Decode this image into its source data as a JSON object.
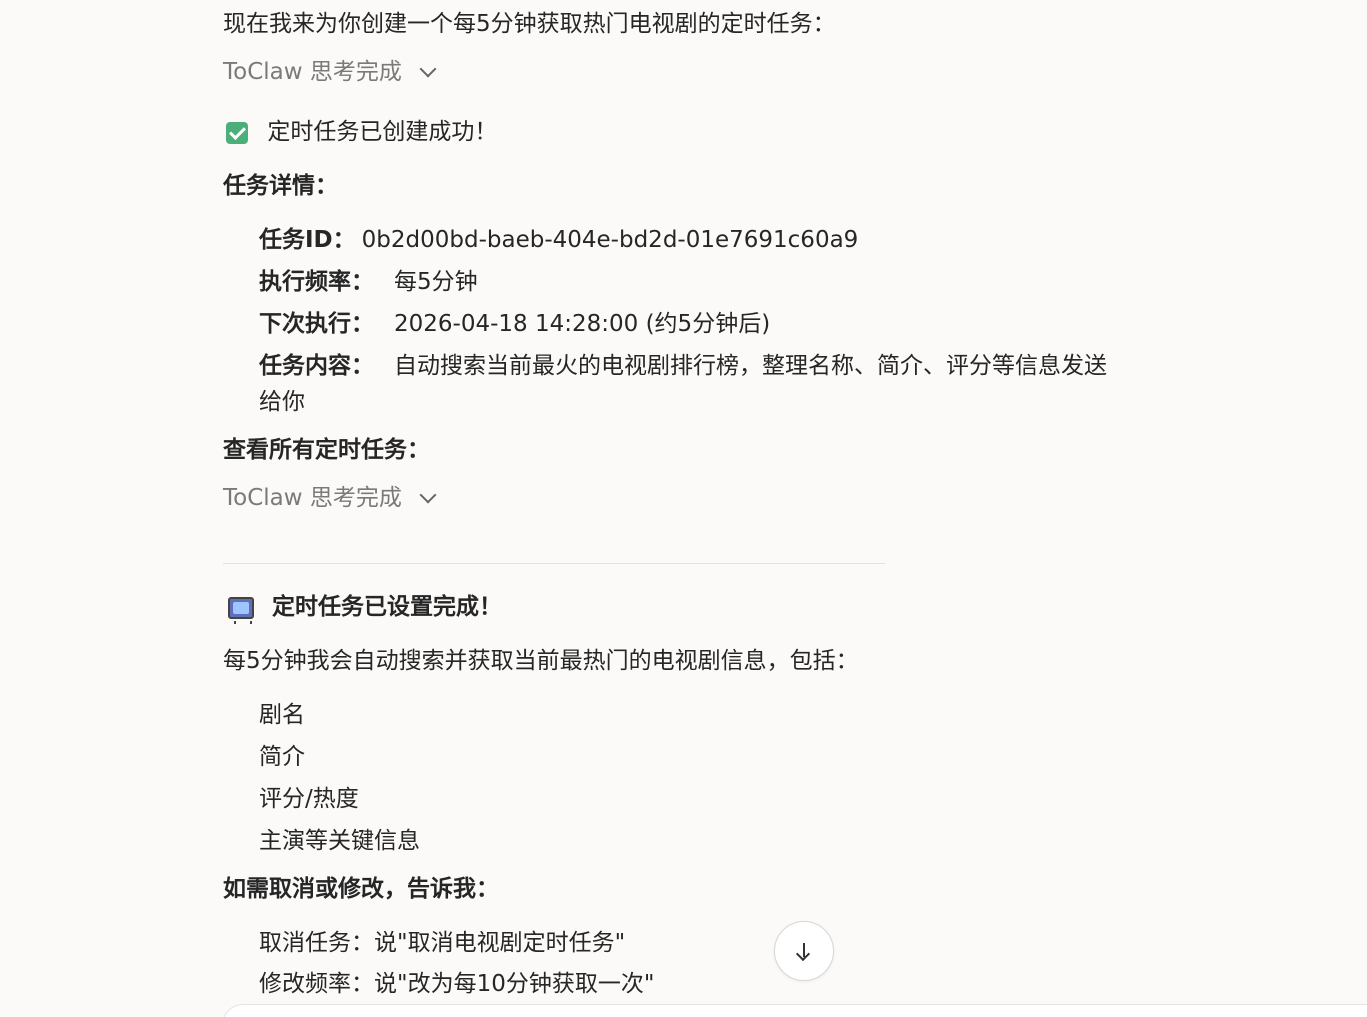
{
  "intro": "现在我来为你创建一个每5分钟获取热门电视剧的定时任务：",
  "thinking_label": "ToClaw 思考完成",
  "success_text": "定时任务已创建成功！",
  "details_heading": "任务详情：",
  "details": {
    "id_key": "任务ID：",
    "id_val": "0b2d00bd-baeb-404e-bd2d-01e7691c60a9",
    "freq_key": "执行频率：",
    "freq_val": "每5分钟",
    "next_key": "下次执行：",
    "next_val": "2026-04-18 14:28:00 (约5分钟后)",
    "content_key": "任务内容：",
    "content_val_line1": "自动搜索当前最火的电视剧排行榜，整理名称、简介、评分等信息发送",
    "content_val_line2": "给你"
  },
  "view_all_heading": "查看所有定时任务：",
  "done_title": "定时任务已设置完成！",
  "summary": "每5分钟我会自动搜索并获取当前最热门的电视剧信息，包括：",
  "info_items": [
    "剧名",
    "简介",
    "评分/热度",
    "主演等关键信息"
  ],
  "cancel_heading": "如需取消或修改，告诉我：",
  "cancel_items": [
    "取消任务：说\"取消电视剧定时任务\"",
    "修改频率：说\"改为每10分钟获取一次\""
  ],
  "icons": {
    "check": "check-icon",
    "tv": "tv-icon",
    "chevron": "chevron-down-icon",
    "scroll": "arrow-down-icon"
  },
  "colors": {
    "background": "#fbfaf8",
    "check_green": "#4caf7a",
    "muted_text": "#7a7a7a"
  }
}
